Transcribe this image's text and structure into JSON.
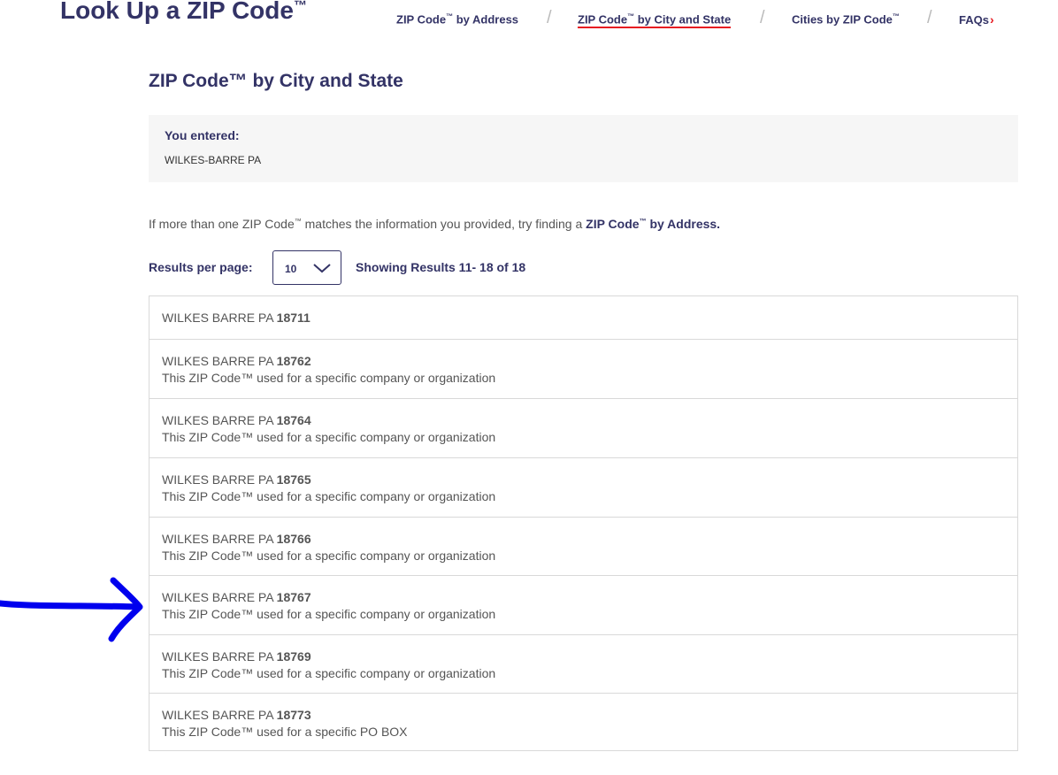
{
  "header": {
    "title": "Look Up a ZIP Code",
    "title_tm": "™"
  },
  "nav": {
    "items": [
      {
        "label": "ZIP Code",
        "tm": "™",
        "suffix": " by Address"
      },
      {
        "label": "ZIP Code",
        "tm": "™",
        "suffix": " by City and State"
      },
      {
        "label": "Cities by ZIP Code",
        "tm": "™",
        "suffix": ""
      },
      {
        "label": "FAQs",
        "tm": "",
        "suffix": ""
      }
    ],
    "separator": "/",
    "faq_chevron": "›",
    "active_underline_color": "#e71921"
  },
  "section": {
    "title": "ZIP Code™ by City and State"
  },
  "entered": {
    "label": "You entered:",
    "value": "WILKES-BARRE PA"
  },
  "info": {
    "prefix": "If more than one ZIP Code",
    "tm": "™",
    "middle": " matches the information you provided, try finding a ",
    "link_label": "ZIP Code",
    "link_tm": "™",
    "link_suffix": " by Address."
  },
  "pagination": {
    "results_per_page_label": "Results per page:",
    "results_per_page_value": "10",
    "showing_text": "Showing Results 11- 18 of 18"
  },
  "results": [
    {
      "prefix": "WILKES BARRE PA ",
      "zip": "18711",
      "note": ""
    },
    {
      "prefix": "WILKES BARRE PA ",
      "zip": "18762",
      "note": "This ZIP Code™ used for a specific company or organization"
    },
    {
      "prefix": "WILKES BARRE PA ",
      "zip": "18764",
      "note": "This ZIP Code™ used for a specific company or organization"
    },
    {
      "prefix": "WILKES BARRE PA ",
      "zip": "18765",
      "note": "This ZIP Code™ used for a specific company or organization"
    },
    {
      "prefix": "WILKES BARRE PA ",
      "zip": "18766",
      "note": "This ZIP Code™ used for a specific company or organization"
    },
    {
      "prefix": "WILKES BARRE PA ",
      "zip": "18767",
      "note": "This ZIP Code™ used for a specific company or organization"
    },
    {
      "prefix": "WILKES BARRE PA ",
      "zip": "18769",
      "note": "This ZIP Code™ used for a specific company or organization"
    },
    {
      "prefix": "WILKES BARRE PA ",
      "zip": "18773",
      "note": "This ZIP Code™ used for a specific PO BOX"
    }
  ],
  "annotation": {
    "icon": "hand-drawn-arrow-icon",
    "color": "#0000ee"
  }
}
